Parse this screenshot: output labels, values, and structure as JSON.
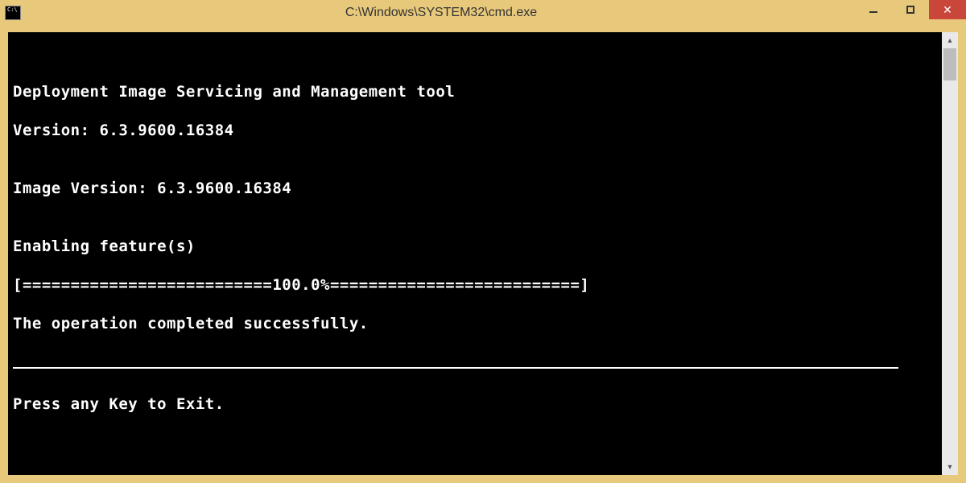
{
  "window": {
    "title": "C:\\Windows\\SYSTEM32\\cmd.exe",
    "icon_label": "C:\\"
  },
  "console": {
    "line_blank_top": "",
    "line_tool": "Deployment Image Servicing and Management tool",
    "line_version": "Version: 6.3.9600.16384",
    "line_blank1": "",
    "line_image_version": "Image Version: 6.3.9600.16384",
    "line_blank2": "",
    "line_enabling": "Enabling feature(s)",
    "line_progress": "[==========================100.0%==========================]",
    "line_success": "The operation completed successfully.",
    "line_blank3": "",
    "line_exit": "Press any Key to Exit."
  },
  "scrollbar": {
    "up_glyph": "▴",
    "down_glyph": "▾"
  }
}
